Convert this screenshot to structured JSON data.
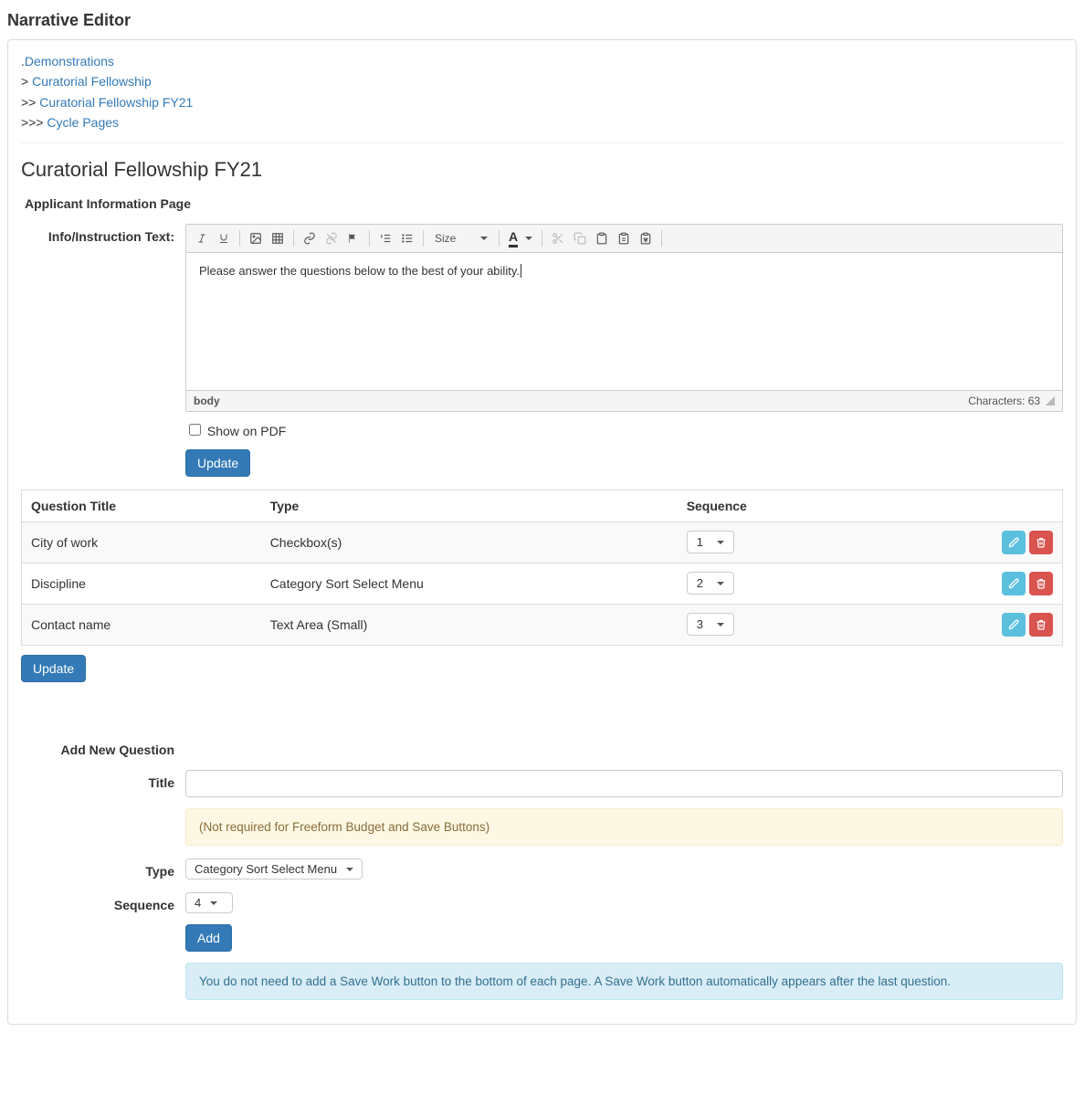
{
  "page_title": "Narrative Editor",
  "breadcrumbs": {
    "level0_prefix": ".",
    "level0": "Demonstrations",
    "level1_prefix": "> ",
    "level1": "Curatorial Fellowship",
    "level2_prefix": ">> ",
    "level2": "Curatorial Fellowship FY21",
    "level3_prefix": ">>> ",
    "level3": "Cycle Pages"
  },
  "heading": "Curatorial Fellowship FY21",
  "section_title": "Applicant Information Page",
  "info_label": "Info/Instruction Text:",
  "editor": {
    "size_label": "Size",
    "body_text": "Please answer the questions below to the best of your ability.",
    "path_label": "body",
    "char_label": "Characters: 63"
  },
  "show_on_pdf_label": "Show on PDF",
  "update_button": "Update",
  "table": {
    "headers": {
      "title": "Question Title",
      "type": "Type",
      "sequence": "Sequence"
    },
    "rows": [
      {
        "title": "City of work",
        "type": "Checkbox(s)",
        "seq": "1"
      },
      {
        "title": "Discipline",
        "type": "Category Sort Select Menu",
        "seq": "2"
      },
      {
        "title": "Contact name",
        "type": "Text Area (Small)",
        "seq": "3"
      }
    ]
  },
  "update_button_2": "Update",
  "add_new": {
    "section_label": "Add New Question",
    "title_label": "Title",
    "hint": "(Not required for Freeform Budget and Save Buttons)",
    "type_label": "Type",
    "type_value": "Category Sort Select Menu",
    "seq_label": "Sequence",
    "seq_value": "4",
    "add_button": "Add",
    "info_note": "You do not need to add a Save Work button to the bottom of each page. A Save Work button automatically appears after the last question."
  }
}
